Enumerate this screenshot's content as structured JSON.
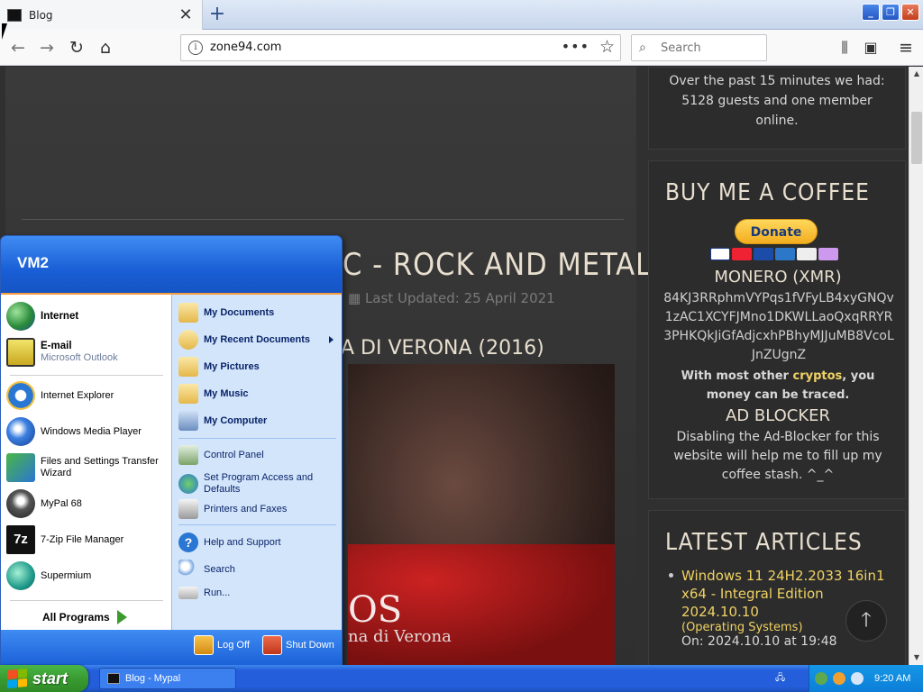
{
  "tab": {
    "title": "Blog"
  },
  "address": {
    "url": "zone94.com"
  },
  "search": {
    "placeholder": "Search"
  },
  "page": {
    "post_title": "C - ROCK AND METAL",
    "post_updated": "Last Updated: 25 April 2021",
    "post_subtitle": "A DI VERONA (2016)",
    "image_caption": "OS",
    "image_caption2": "na di Verona",
    "sidebar": {
      "online_text": "Over the past 15 minutes we had: 5128 guests and one member online.",
      "coffee_heading": "BUY ME A COFFEE",
      "donate_label": "Donate",
      "monero_label": "MONERO (XMR)",
      "monero_address": "84KJ3RRphmVYPqs1fVFyLB4xyGNQv1zAC1XCYFJMno1DKWLLaoQxqRRYR3PHKQkJiGfAdjcxhPBhyMJJuMB8VcoLJnZUgnZ",
      "crypto_prefix": "With most other ",
      "crypto_link": "cryptos",
      "crypto_suffix": ", you money can be traced.",
      "adblock_label": "AD BLOCKER",
      "adblock_text": "Disabling the Ad-Blocker for this website will help me to fill up my coffee stash. ^_^",
      "latest_heading": "LATEST ARTICLES",
      "latest": [
        {
          "title": "Windows 11 24H2.2033 16in1 x64 - Integral Edition 2024.10.10",
          "category": "(Operating Systems)",
          "date": "On: 2024.10.10 at 19:48"
        }
      ]
    }
  },
  "start_menu": {
    "user": "VM2",
    "pinned": [
      {
        "label": "Internet",
        "bold": true
      },
      {
        "label": "E-mail",
        "sub": "Microsoft Outlook",
        "bold": true
      }
    ],
    "recent": [
      "Internet Explorer",
      "Windows Media Player",
      "Files and Settings Transfer Wizard",
      "MyPal 68",
      "7-Zip File Manager",
      "Supermium"
    ],
    "all_programs": "All Programs",
    "right_top": [
      "My Documents",
      "My Recent Documents",
      "My Pictures",
      "My Music",
      "My Computer"
    ],
    "right_mid": [
      "Control Panel",
      "Set Program Access and Defaults",
      "Printers and Faxes"
    ],
    "right_bottom": [
      "Help and Support",
      "Search",
      "Run..."
    ],
    "log_off": "Log Off",
    "shut_down": "Shut Down"
  },
  "taskbar": {
    "start_label": "start",
    "window_item": "Blog - Mypal",
    "clock": "9:20 AM"
  },
  "colors": {
    "xp_blue": "#245edb",
    "start_green": "#3a9b32",
    "accent_yellow": "#f0d264",
    "heading_cream": "#e8dfcf"
  },
  "icons": {
    "tab": "site-favicon",
    "nav_back": "arrow-left-icon",
    "nav_forward": "arrow-right-icon",
    "nav_reload": "reload-icon",
    "nav_home": "home-icon",
    "library": "library-icon",
    "sidebar": "sidebar-icon",
    "menu": "hamburger-icon"
  }
}
